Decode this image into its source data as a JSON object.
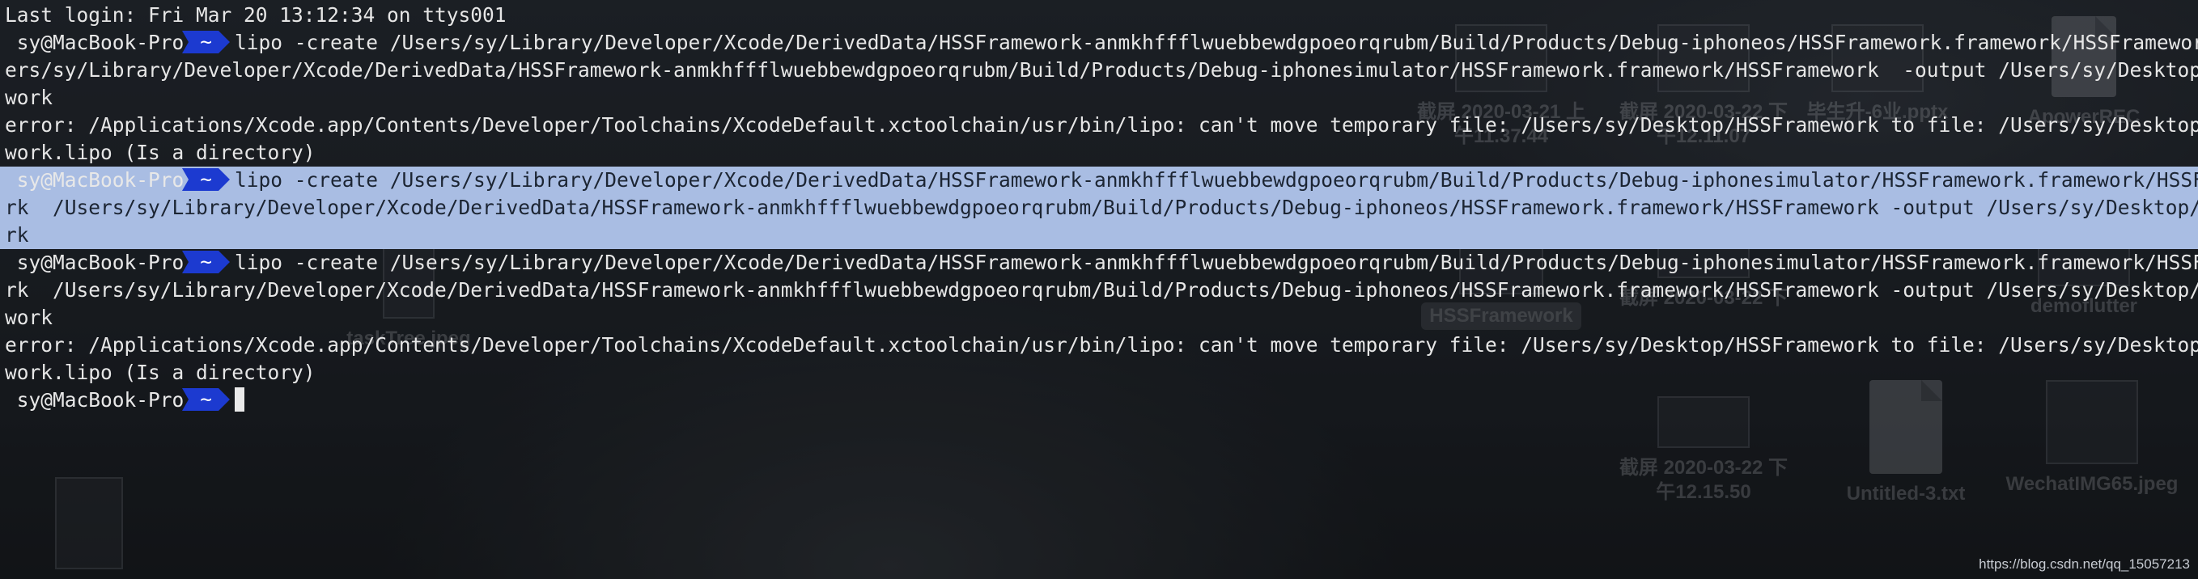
{
  "terminal": {
    "last_login": "Last login: Fri Mar 20 13:12:34 on ttys001",
    "prompt": {
      "host": "sy@MacBook-Pro",
      "dir": "~"
    },
    "lines": [
      {
        "type": "cmd",
        "text": "lipo -create /Users/sy/Library/Developer/Xcode/DerivedData/HSSFramework-anmkhffflwuebbewdgpoeorqrubm/Build/Products/Debug-iphoneos/HSSFramework.framework/HSSFramework  /Us"
      },
      {
        "type": "out",
        "text": "ers/sy/Library/Developer/Xcode/DerivedData/HSSFramework-anmkhffflwuebbewdgpoeorqrubm/Build/Products/Debug-iphonesimulator/HSSFramework.framework/HSSFramework  -output /Users/sy/Desktop/HSSFrame"
      },
      {
        "type": "out",
        "text": "work"
      },
      {
        "type": "out",
        "text": "error: /Applications/Xcode.app/Contents/Developer/Toolchains/XcodeDefault.xctoolchain/usr/bin/lipo: can't move temporary file: /Users/sy/Desktop/HSSFramework to file: /Users/sy/Desktop/HSSFrame"
      },
      {
        "type": "out",
        "text": "work.lipo (Is a directory)"
      },
      {
        "type": "cmd",
        "selected": true,
        "text": "lipo -create /Users/sy/Library/Developer/Xcode/DerivedData/HSSFramework-anmkhffflwuebbewdgpoeorqrubm/Build/Products/Debug-iphonesimulator/HSSFramework.framework/HSSFramewo"
      },
      {
        "type": "out",
        "selected": true,
        "text": "rk  /Users/sy/Library/Developer/Xcode/DerivedData/HSSFramework-anmkhffflwuebbewdgpoeorqrubm/Build/Products/Debug-iphoneos/HSSFramework.framework/HSSFramework -output /Users/sy/Desktop/HSSFramwo"
      },
      {
        "type": "out",
        "selected": true,
        "text": "rk"
      },
      {
        "type": "cmd",
        "text": "lipo -create /Users/sy/Library/Developer/Xcode/DerivedData/HSSFramework-anmkhffflwuebbewdgpoeorqrubm/Build/Products/Debug-iphonesimulator/HSSFramework.framework/HSSFramewo"
      },
      {
        "type": "out",
        "text": "rk  /Users/sy/Library/Developer/Xcode/DerivedData/HSSFramework-anmkhffflwuebbewdgpoeorqrubm/Build/Products/Debug-iphoneos/HSSFramework.framework/HSSFramework -output /Users/sy/Desktop/HSSFrame"
      },
      {
        "type": "out",
        "text": "work"
      },
      {
        "type": "out",
        "text": "error: /Applications/Xcode.app/Contents/Developer/Toolchains/XcodeDefault.xctoolchain/usr/bin/lipo: can't move temporary file: /Users/sy/Desktop/HSSFramework to file: /Users/sy/Desktop/HSSFrame"
      },
      {
        "type": "out",
        "text": "work.lipo (Is a directory)"
      },
      {
        "type": "cmd",
        "cursor": true,
        "text": ""
      }
    ]
  },
  "desktop": {
    "items": [
      {
        "label": "截屏 2020-03-21 上午11.37.44"
      },
      {
        "label": "截屏 2020-03-22 下午12.11.07"
      },
      {
        "label": "毕生升-6业.pptx"
      },
      {
        "label": "ApowerREC"
      },
      {
        "label": "HSSFramework",
        "selected": true
      },
      {
        "label": "截屏 2020-03-22 下"
      },
      {
        "label": "demoflutter"
      },
      {
        "label": "taskTree.jpeg"
      },
      {
        "label": "截屏 2020-03-22 下午12.15.50"
      },
      {
        "label": "Untitled-3.txt"
      },
      {
        "label": "WechatIMG65.jpeg"
      }
    ]
  },
  "watermark": "https://blog.csdn.net/qq_15057213",
  "colors": {
    "prompt_segment": "#1c3ad0",
    "selection": "#a9bde3",
    "text": "#e6e6e6"
  }
}
